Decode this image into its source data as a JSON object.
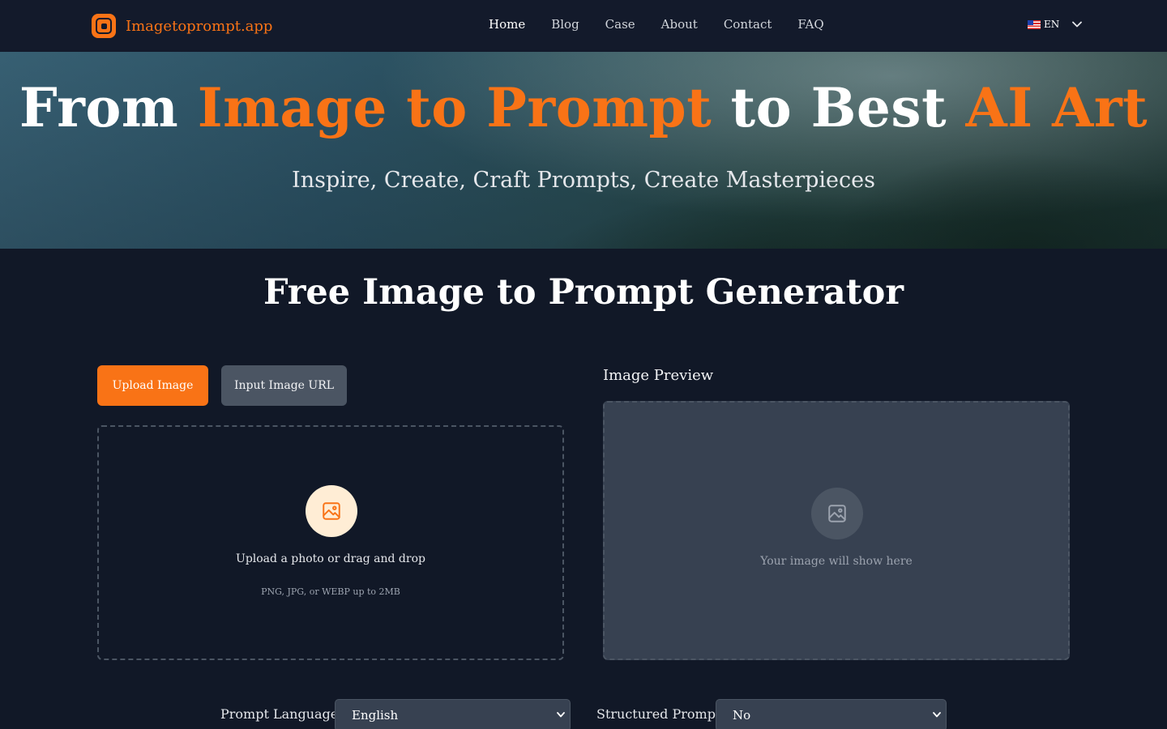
{
  "header": {
    "logo_text": "Imagetoprompt.app",
    "nav": [
      "Home",
      "Blog",
      "Case",
      "About",
      "Contact",
      "FAQ"
    ],
    "language": "EN"
  },
  "hero": {
    "title_part1": "From ",
    "title_accent1": "Image to Prompt",
    "title_part2": " to Best ",
    "title_accent2": "AI Art",
    "subtitle": "Inspire, Create, Craft Prompts, Create Masterpieces"
  },
  "main": {
    "title": "Free Image to Prompt Generator",
    "tabs": [
      "Upload Image",
      "Input Image URL"
    ],
    "dropzone": {
      "main_text": "Upload a photo or drag and drop",
      "sub_text": "PNG, JPG, or WEBP up to 2MB"
    },
    "preview": {
      "label": "Image Preview",
      "placeholder": "Your image will show here"
    },
    "options": {
      "language_label": "Prompt Language",
      "language_value": "English",
      "structured_label": "Structured Prompt",
      "structured_value": "No"
    }
  },
  "colors": {
    "accent": "#f97316",
    "background": "#111827",
    "header": "#131a2b",
    "panel": "#374151"
  },
  "icons": [
    "logo-icon",
    "flag-us-icon",
    "chevron-down-icon",
    "image-icon"
  ]
}
